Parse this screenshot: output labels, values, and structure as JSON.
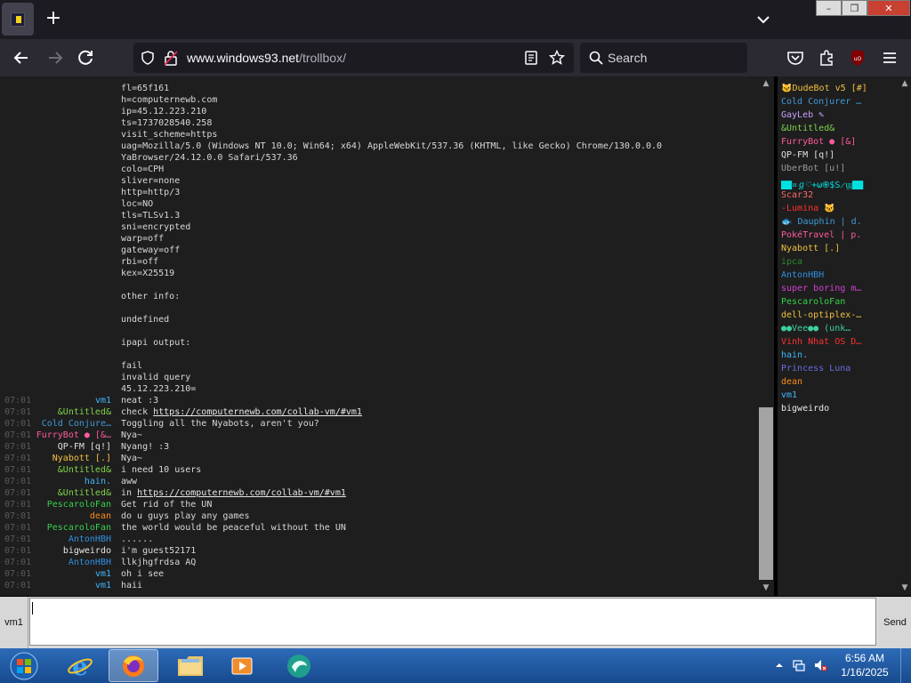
{
  "browser": {
    "url_domain": "www.windows93.net",
    "url_path": "/trollbox/",
    "search_placeholder": "Search",
    "window_buttons": [
      "–",
      "❐",
      "✕"
    ],
    "new_tab": "+"
  },
  "chat": {
    "log": [
      {
        "time": "",
        "nick": "",
        "nick_color": "",
        "text": "fl=65f161"
      },
      {
        "time": "",
        "nick": "",
        "nick_color": "",
        "text": "h=computernewb.com"
      },
      {
        "time": "",
        "nick": "",
        "nick_color": "",
        "text": "ip=45.12.223.210"
      },
      {
        "time": "",
        "nick": "",
        "nick_color": "",
        "text": "ts=1737028540.258"
      },
      {
        "time": "",
        "nick": "",
        "nick_color": "",
        "text": "visit_scheme=https"
      },
      {
        "time": "",
        "nick": "",
        "nick_color": "",
        "text": "uag=Mozilla/5.0 (Windows NT 10.0; Win64; x64) AppleWebKit/537.36 (KHTML, like Gecko) Chrome/130.0.0.0"
      },
      {
        "time": "",
        "nick": "",
        "nick_color": "",
        "text": "YaBrowser/24.12.0.0 Safari/537.36"
      },
      {
        "time": "",
        "nick": "",
        "nick_color": "",
        "text": "colo=CPH"
      },
      {
        "time": "",
        "nick": "",
        "nick_color": "",
        "text": "sliver=none"
      },
      {
        "time": "",
        "nick": "",
        "nick_color": "",
        "text": "http=http/3"
      },
      {
        "time": "",
        "nick": "",
        "nick_color": "",
        "text": "loc=NO"
      },
      {
        "time": "",
        "nick": "",
        "nick_color": "",
        "text": "tls=TLSv1.3"
      },
      {
        "time": "",
        "nick": "",
        "nick_color": "",
        "text": "sni=encrypted"
      },
      {
        "time": "",
        "nick": "",
        "nick_color": "",
        "text": "warp=off"
      },
      {
        "time": "",
        "nick": "",
        "nick_color": "",
        "text": "gateway=off"
      },
      {
        "time": "",
        "nick": "",
        "nick_color": "",
        "text": "rbi=off"
      },
      {
        "time": "",
        "nick": "",
        "nick_color": "",
        "text": "kex=X25519"
      },
      {
        "time": "",
        "nick": "",
        "nick_color": "",
        "text": ""
      },
      {
        "time": "",
        "nick": "",
        "nick_color": "",
        "text": "other info:"
      },
      {
        "time": "",
        "nick": "",
        "nick_color": "",
        "text": ""
      },
      {
        "time": "",
        "nick": "",
        "nick_color": "",
        "text": "undefined"
      },
      {
        "time": "",
        "nick": "",
        "nick_color": "",
        "text": ""
      },
      {
        "time": "",
        "nick": "",
        "nick_color": "",
        "text": "ipapi output:"
      },
      {
        "time": "",
        "nick": "",
        "nick_color": "",
        "text": ""
      },
      {
        "time": "",
        "nick": "",
        "nick_color": "",
        "text": "fail"
      },
      {
        "time": "",
        "nick": "",
        "nick_color": "",
        "text": "invalid query"
      },
      {
        "time": "",
        "nick": "",
        "nick_color": "",
        "text": "45.12.223.210="
      },
      {
        "time": "07:01",
        "nick": "vm1",
        "nick_color": "#3fb6ff",
        "text": "neat :3"
      },
      {
        "time": "07:01",
        "nick": "&Untitled&",
        "nick_color": "#7fd24a",
        "text": "check ",
        "link": "https://computernewb.com/collab-vm/#vm1"
      },
      {
        "time": "07:01",
        "nick": "Cold Conjure…",
        "nick_color": "#3f9ad8",
        "text": "Toggling all the Nyabots, aren't you?"
      },
      {
        "time": "07:01",
        "nick": "FurryBot ● [&…",
        "nick_color": "#ff5a9e",
        "text": "Nya~"
      },
      {
        "time": "07:01",
        "nick": "QP-FM [q!]",
        "nick_color": "#e0e0e0",
        "text": "Nyang! :3"
      },
      {
        "time": "07:01",
        "nick": "Nyabott [.]",
        "nick_color": "#f0c040",
        "text": "Nya~"
      },
      {
        "time": "07:01",
        "nick": "&Untitled&",
        "nick_color": "#7fd24a",
        "text": "i need 10 users"
      },
      {
        "time": "07:01",
        "nick": "hain.",
        "nick_color": "#3fb6ff",
        "text": "aww"
      },
      {
        "time": "07:01",
        "nick": "&Untitled&",
        "nick_color": "#7fd24a",
        "text": "in ",
        "link": "https://computernewb.com/collab-vm/#vm1"
      },
      {
        "time": "07:01",
        "nick": "PescaroloFan",
        "nick_color": "#35d04a",
        "text": "Get rid of the UN"
      },
      {
        "time": "07:01",
        "nick": "dean",
        "nick_color": "#ff8c1a",
        "text": "do u guys play any games"
      },
      {
        "time": "07:01",
        "nick": "PescaroloFan",
        "nick_color": "#35d04a",
        "text": "the world would be peaceful without the UN"
      },
      {
        "time": "07:01",
        "nick": "AntonHBH",
        "nick_color": "#2f8fe0",
        "text": "......"
      },
      {
        "time": "07:01",
        "nick": "bigweirdo",
        "nick_color": "#e8e8e8",
        "text": "i'm guest52171"
      },
      {
        "time": "07:01",
        "nick": "AntonHBH",
        "nick_color": "#2f8fe0",
        "text": "llkjhgfrdsa AQ"
      },
      {
        "time": "07:01",
        "nick": "vm1",
        "nick_color": "#3fb6ff",
        "text": "oh i see"
      },
      {
        "time": "07:01",
        "nick": "vm1",
        "nick_color": "#3fb6ff",
        "text": "haii"
      }
    ],
    "users": [
      {
        "name": "🐱DudeBot v5 [#]",
        "color": "#f0c040"
      },
      {
        "name": "Cold Conjurer …",
        "color": "#3f9ad8"
      },
      {
        "name": "GayLeb ✎",
        "color": "#c8a0ff"
      },
      {
        "name": "&Untitled&",
        "color": "#7fd24a"
      },
      {
        "name": "FurryBot ● [&]",
        "color": "#ff5a9e"
      },
      {
        "name": "QP-FM [q!]",
        "color": "#e0e0e0"
      },
      {
        "name": "UberBot [u!]",
        "color": "#9a9a9a"
      },
      {
        "name": "▇▇¤ℊ♡+ω֍$S̷ϣ▇▇",
        "color": "#00e0e0"
      },
      {
        "name": "Scar32",
        "color": "#ff6a6a"
      },
      {
        "name": "-Lumina 🐱",
        "color": "#ff3030"
      },
      {
        "name": "🐟 Dauphin | d.",
        "color": "#3f9ad8"
      },
      {
        "name": "PokéTravel | p.",
        "color": "#ff5a9e"
      },
      {
        "name": "Nyabott [.]",
        "color": "#f0c040"
      },
      {
        "name": "ipca",
        "color": "#2a8a2a"
      },
      {
        "name": "AntonHBH",
        "color": "#2f8fe0"
      },
      {
        "name": "super boring m…",
        "color": "#d040d0"
      },
      {
        "name": "PescaroloFan",
        "color": "#35d04a"
      },
      {
        "name": "dell-optiplex-…",
        "color": "#f0c040"
      },
      {
        "name": "●●Vee●● (unk…",
        "color": "#3fd0a0"
      },
      {
        "name": "Vinh Nhat OS D…",
        "color": "#ff3030"
      },
      {
        "name": "hain.",
        "color": "#3fb6ff"
      },
      {
        "name": "Princess Luna",
        "color": "#6a6ae0"
      },
      {
        "name": "dean",
        "color": "#ff8c1a"
      },
      {
        "name": "vm1",
        "color": "#3fb6ff"
      },
      {
        "name": "bigweirdo",
        "color": "#e8e8e8"
      }
    ]
  },
  "input": {
    "nick_label": "vm1",
    "message_value": "",
    "send_label": "Send"
  },
  "taskbar": {
    "time": "6:56 AM",
    "date": "1/16/2025"
  }
}
